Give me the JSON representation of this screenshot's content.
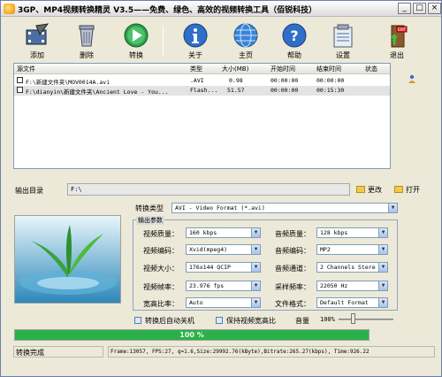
{
  "window": {
    "title": "3GP、MP4视频转换精灵 V3.5——免费、绿色、高效的视频转换工具（佰锐科技）",
    "minimize": "_",
    "maximize": "□",
    "close": "×"
  },
  "toolbar": {
    "add": "添加",
    "delete": "删除",
    "convert": "转换",
    "about": "关于",
    "home": "主页",
    "help": "帮助",
    "settings": "设置",
    "exit": "退出"
  },
  "file_list": {
    "headers": {
      "name": "源文件",
      "type": "类型",
      "size": "大小(MB)",
      "start": "开始时间",
      "end": "结束时间",
      "status": "状态"
    },
    "rows": [
      {
        "name": "F:\\新建文件夹\\MOV0014A.avi",
        "type": ".AVI",
        "size": "0.98",
        "start": "00:00:00",
        "end": "00:00:00",
        "status": ""
      },
      {
        "name": "F:\\dianyin\\新建文件夹\\Ancient Love - You...",
        "type": "Flash...",
        "size": "51.57",
        "start": "00:00:00",
        "end": "00:15:30",
        "status": ""
      }
    ]
  },
  "output": {
    "label": "输出目录",
    "path": "F:\\",
    "change": "更改",
    "open": "打开"
  },
  "convert_type": {
    "label": "转换类型",
    "value": "AVI - Video Format (*.avi)"
  },
  "settings": {
    "group_title": "输出参数",
    "video_quality_label": "视频质量：",
    "video_quality": "160 kbps",
    "video_codec_label": "视频编码：",
    "video_codec": "Xvid(mpeg4)",
    "video_size_label": "视频大小：",
    "video_size": "176x144 QCIP",
    "frame_rate_label": "视频帧率：",
    "frame_rate": "23.976 fps",
    "aspect_label": "宽高比率：",
    "aspect": "Auto",
    "audio_quality_label": "音频质量：",
    "audio_quality": "128 kbps",
    "audio_codec_label": "音频编码：",
    "audio_codec": "MP2",
    "audio_channel_label": "音频通道：",
    "audio_channel": "2 Channels Stere",
    "sample_rate_label": "采样频率：",
    "sample_rate": "22050 Hz",
    "file_format_label": "文件格式：",
    "file_format": "Default Format"
  },
  "options": {
    "shutdown": "转换后自动关机",
    "keep_aspect": "保持视频宽高比",
    "volume_label": "音量",
    "volume_value": "100%",
    "volume_level": 0.25
  },
  "progress": {
    "percent": 100,
    "text": "100 %"
  },
  "status_bar": {
    "status": "转换完成",
    "info": "Frame:13057, FPS:27, q=1.6,Size:29992.76(kByte),Bitrate:265.27(kbps), Time:926.22"
  }
}
